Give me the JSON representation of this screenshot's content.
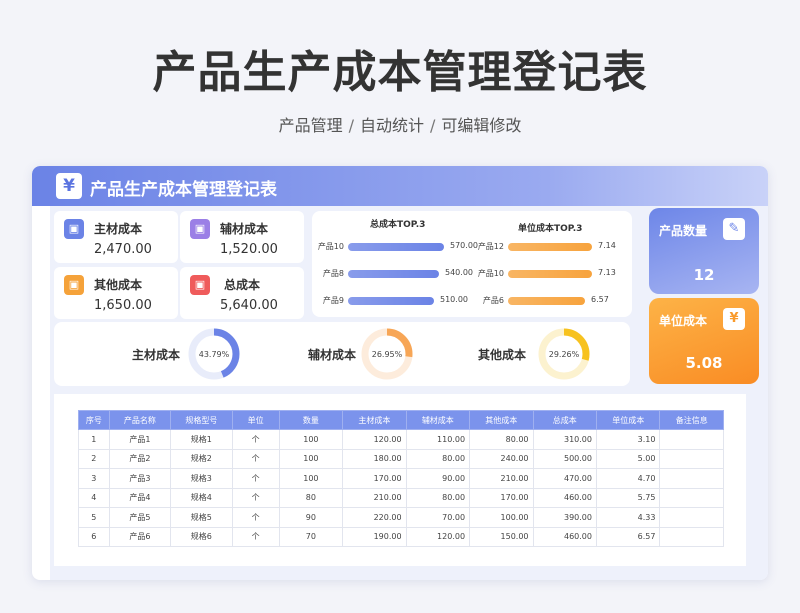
{
  "page": {
    "title": "产品生产成本管理登记表",
    "subtitle_parts": [
      "产品管理",
      "自动统计",
      "可编辑修改"
    ],
    "separator": "/"
  },
  "card": {
    "header_icon": "¥",
    "header_title": "产品生产成本管理登记表"
  },
  "stats": {
    "main_material": {
      "label": "主材成本",
      "value": "2,470.00",
      "icon": "box-icon",
      "color": "#6b83e6"
    },
    "aux_material": {
      "label": "辅材成本",
      "value": "1,520.00",
      "icon": "box-icon",
      "color": "#9b7fe6"
    },
    "other": {
      "label": "其他成本",
      "value": "1,650.00",
      "icon": "box-icon",
      "color": "#f5a23a"
    },
    "total": {
      "label": "总成本",
      "value": "5,640.00",
      "icon": "box-icon",
      "color": "#ef5b5b"
    }
  },
  "top3_total": {
    "title": "总成本TOP.3",
    "items": [
      {
        "name": "产品10",
        "value": 570.0,
        "label": "570.00"
      },
      {
        "name": "产品8",
        "value": 540.0,
        "label": "540.00"
      },
      {
        "name": "产品9",
        "value": 510.0,
        "label": "510.00"
      }
    ],
    "color": "#6b83e6"
  },
  "top3_unit": {
    "title": "单位成本TOP.3",
    "items": [
      {
        "name": "产品12",
        "value": 7.14,
        "label": "7.14"
      },
      {
        "name": "产品10",
        "value": 7.13,
        "label": "7.13"
      },
      {
        "name": "产品6",
        "value": 6.57,
        "label": "6.57"
      }
    ],
    "color": "#f7a33d"
  },
  "kpis": {
    "count": {
      "label": "产品数量",
      "value": "12",
      "icon": "edit-icon",
      "color": "#7b90ea"
    },
    "unit_cost": {
      "label": "单位成本",
      "value": "5.08",
      "icon": "yen-icon",
      "color": "#f99a2b"
    }
  },
  "donuts": [
    {
      "label": "主材成本",
      "percent": 43.79,
      "text": "43.79%",
      "color": "#6b83e6",
      "track": "#e8ecfa"
    },
    {
      "label": "辅材成本",
      "percent": 26.95,
      "text": "26.95%",
      "color": "#f7a656",
      "track": "#fdecdc"
    },
    {
      "label": "其他成本",
      "percent": 29.26,
      "text": "29.26%",
      "color": "#f7c21f",
      "track": "#fcf2cf"
    }
  ],
  "table": {
    "headers": [
      "序号",
      "产品名称",
      "规格型号",
      "单位",
      "数量",
      "主材成本",
      "辅材成本",
      "其他成本",
      "总成本",
      "单位成本",
      "备注信息"
    ],
    "rows": [
      [
        "1",
        "产品1",
        "规格1",
        "个",
        "100",
        "120.00",
        "110.00",
        "80.00",
        "310.00",
        "3.10",
        ""
      ],
      [
        "2",
        "产品2",
        "规格2",
        "个",
        "100",
        "180.00",
        "80.00",
        "240.00",
        "500.00",
        "5.00",
        ""
      ],
      [
        "3",
        "产品3",
        "规格3",
        "个",
        "100",
        "170.00",
        "90.00",
        "210.00",
        "470.00",
        "4.70",
        ""
      ],
      [
        "4",
        "产品4",
        "规格4",
        "个",
        "80",
        "210.00",
        "80.00",
        "170.00",
        "460.00",
        "5.75",
        ""
      ],
      [
        "5",
        "产品5",
        "规格5",
        "个",
        "90",
        "220.00",
        "70.00",
        "100.00",
        "390.00",
        "4.33",
        ""
      ],
      [
        "6",
        "产品6",
        "规格6",
        "个",
        "70",
        "190.00",
        "120.00",
        "150.00",
        "460.00",
        "6.57",
        ""
      ]
    ]
  }
}
